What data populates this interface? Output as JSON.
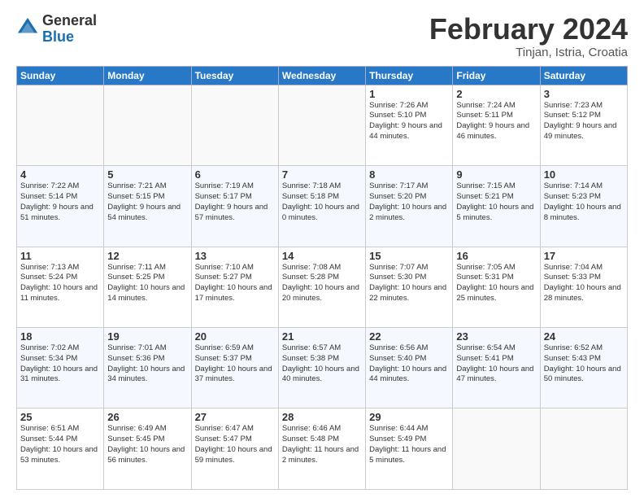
{
  "logo": {
    "general": "General",
    "blue": "Blue"
  },
  "title": "February 2024",
  "location": "Tinjan, Istria, Croatia",
  "weekdays": [
    "Sunday",
    "Monday",
    "Tuesday",
    "Wednesday",
    "Thursday",
    "Friday",
    "Saturday"
  ],
  "weeks": [
    [
      {
        "day": "",
        "sunrise": "",
        "sunset": "",
        "daylight": ""
      },
      {
        "day": "",
        "sunrise": "",
        "sunset": "",
        "daylight": ""
      },
      {
        "day": "",
        "sunrise": "",
        "sunset": "",
        "daylight": ""
      },
      {
        "day": "",
        "sunrise": "",
        "sunset": "",
        "daylight": ""
      },
      {
        "day": "1",
        "sunrise": "7:26 AM",
        "sunset": "5:10 PM",
        "daylight": "9 hours and 44 minutes."
      },
      {
        "day": "2",
        "sunrise": "7:24 AM",
        "sunset": "5:11 PM",
        "daylight": "9 hours and 46 minutes."
      },
      {
        "day": "3",
        "sunrise": "7:23 AM",
        "sunset": "5:12 PM",
        "daylight": "9 hours and 49 minutes."
      }
    ],
    [
      {
        "day": "4",
        "sunrise": "7:22 AM",
        "sunset": "5:14 PM",
        "daylight": "9 hours and 51 minutes."
      },
      {
        "day": "5",
        "sunrise": "7:21 AM",
        "sunset": "5:15 PM",
        "daylight": "9 hours and 54 minutes."
      },
      {
        "day": "6",
        "sunrise": "7:19 AM",
        "sunset": "5:17 PM",
        "daylight": "9 hours and 57 minutes."
      },
      {
        "day": "7",
        "sunrise": "7:18 AM",
        "sunset": "5:18 PM",
        "daylight": "10 hours and 0 minutes."
      },
      {
        "day": "8",
        "sunrise": "7:17 AM",
        "sunset": "5:20 PM",
        "daylight": "10 hours and 2 minutes."
      },
      {
        "day": "9",
        "sunrise": "7:15 AM",
        "sunset": "5:21 PM",
        "daylight": "10 hours and 5 minutes."
      },
      {
        "day": "10",
        "sunrise": "7:14 AM",
        "sunset": "5:23 PM",
        "daylight": "10 hours and 8 minutes."
      }
    ],
    [
      {
        "day": "11",
        "sunrise": "7:13 AM",
        "sunset": "5:24 PM",
        "daylight": "10 hours and 11 minutes."
      },
      {
        "day": "12",
        "sunrise": "7:11 AM",
        "sunset": "5:25 PM",
        "daylight": "10 hours and 14 minutes."
      },
      {
        "day": "13",
        "sunrise": "7:10 AM",
        "sunset": "5:27 PM",
        "daylight": "10 hours and 17 minutes."
      },
      {
        "day": "14",
        "sunrise": "7:08 AM",
        "sunset": "5:28 PM",
        "daylight": "10 hours and 20 minutes."
      },
      {
        "day": "15",
        "sunrise": "7:07 AM",
        "sunset": "5:30 PM",
        "daylight": "10 hours and 22 minutes."
      },
      {
        "day": "16",
        "sunrise": "7:05 AM",
        "sunset": "5:31 PM",
        "daylight": "10 hours and 25 minutes."
      },
      {
        "day": "17",
        "sunrise": "7:04 AM",
        "sunset": "5:33 PM",
        "daylight": "10 hours and 28 minutes."
      }
    ],
    [
      {
        "day": "18",
        "sunrise": "7:02 AM",
        "sunset": "5:34 PM",
        "daylight": "10 hours and 31 minutes."
      },
      {
        "day": "19",
        "sunrise": "7:01 AM",
        "sunset": "5:36 PM",
        "daylight": "10 hours and 34 minutes."
      },
      {
        "day": "20",
        "sunrise": "6:59 AM",
        "sunset": "5:37 PM",
        "daylight": "10 hours and 37 minutes."
      },
      {
        "day": "21",
        "sunrise": "6:57 AM",
        "sunset": "5:38 PM",
        "daylight": "10 hours and 40 minutes."
      },
      {
        "day": "22",
        "sunrise": "6:56 AM",
        "sunset": "5:40 PM",
        "daylight": "10 hours and 44 minutes."
      },
      {
        "day": "23",
        "sunrise": "6:54 AM",
        "sunset": "5:41 PM",
        "daylight": "10 hours and 47 minutes."
      },
      {
        "day": "24",
        "sunrise": "6:52 AM",
        "sunset": "5:43 PM",
        "daylight": "10 hours and 50 minutes."
      }
    ],
    [
      {
        "day": "25",
        "sunrise": "6:51 AM",
        "sunset": "5:44 PM",
        "daylight": "10 hours and 53 minutes."
      },
      {
        "day": "26",
        "sunrise": "6:49 AM",
        "sunset": "5:45 PM",
        "daylight": "10 hours and 56 minutes."
      },
      {
        "day": "27",
        "sunrise": "6:47 AM",
        "sunset": "5:47 PM",
        "daylight": "10 hours and 59 minutes."
      },
      {
        "day": "28",
        "sunrise": "6:46 AM",
        "sunset": "5:48 PM",
        "daylight": "11 hours and 2 minutes."
      },
      {
        "day": "29",
        "sunrise": "6:44 AM",
        "sunset": "5:49 PM",
        "daylight": "11 hours and 5 minutes."
      },
      {
        "day": "",
        "sunrise": "",
        "sunset": "",
        "daylight": ""
      },
      {
        "day": "",
        "sunrise": "",
        "sunset": "",
        "daylight": ""
      }
    ]
  ],
  "labels": {
    "sunrise_prefix": "Sunrise: ",
    "sunset_prefix": "Sunset: ",
    "daylight_prefix": "Daylight: "
  }
}
